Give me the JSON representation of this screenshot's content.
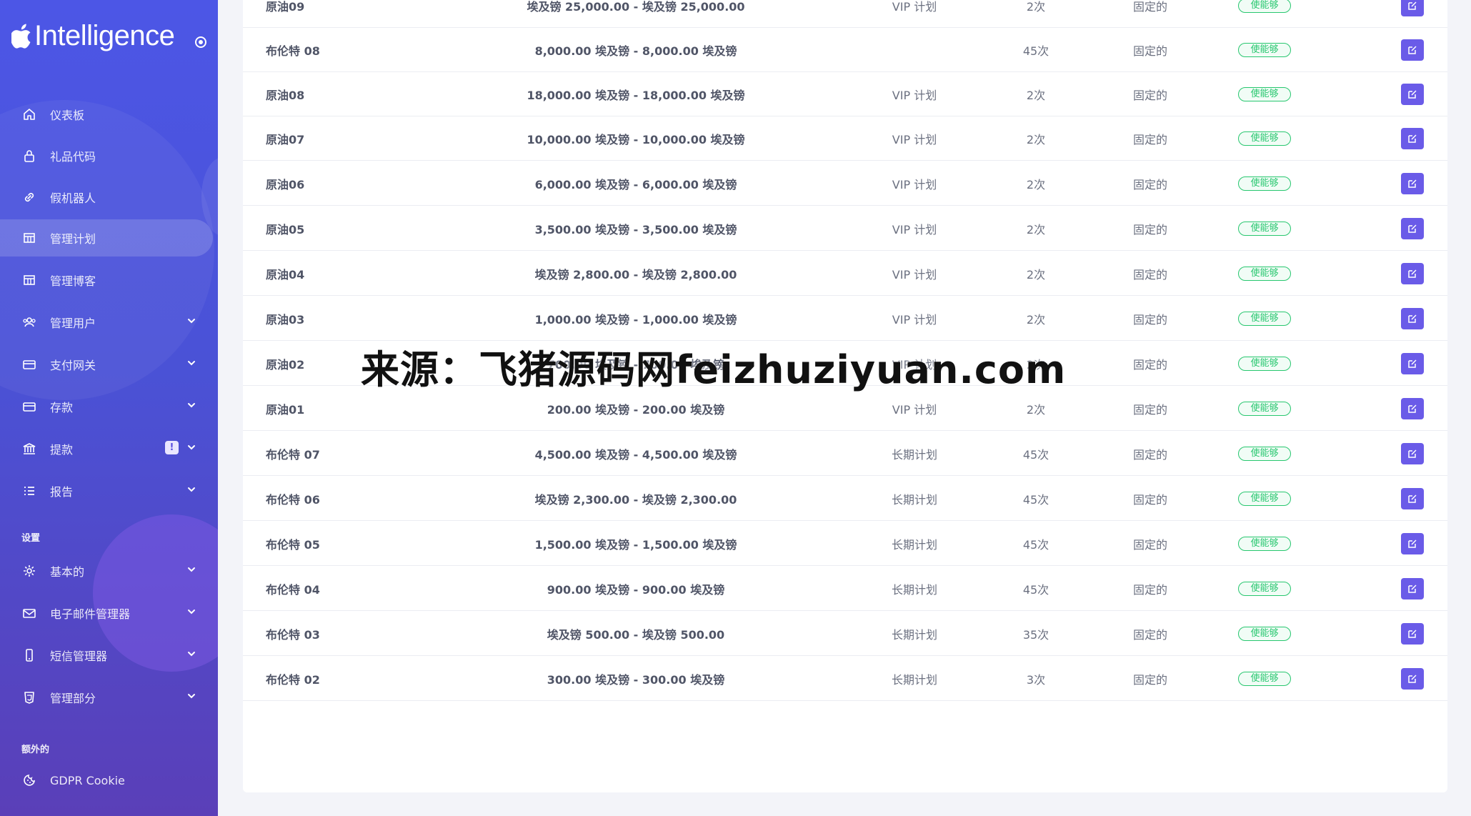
{
  "sidebar": {
    "brand": "Intelligence",
    "nav": [
      {
        "label": "仪表板",
        "icon": "home-icon"
      },
      {
        "label": "礼品代码",
        "icon": "lock-icon"
      },
      {
        "label": "假机器人",
        "icon": "link-icon"
      },
      {
        "label": "管理计划",
        "icon": "grid-icon",
        "active": true
      },
      {
        "label": "管理博客",
        "icon": "grid-icon"
      },
      {
        "label": "管理用户",
        "icon": "users-icon",
        "has_submenu": true
      },
      {
        "label": "支付网关",
        "icon": "card-icon",
        "has_submenu": true
      },
      {
        "label": "存款",
        "icon": "card-icon",
        "has_submenu": true
      },
      {
        "label": "提款",
        "icon": "bank-icon",
        "has_submenu": true,
        "badge": "!"
      },
      {
        "label": "报告",
        "icon": "list-icon",
        "has_submenu": true
      }
    ],
    "settings_section": "设置",
    "settings": [
      {
        "label": "基本的",
        "icon": "gear-icon"
      },
      {
        "label": "电子邮件管理器",
        "icon": "mail-icon"
      },
      {
        "label": "短信管理器",
        "icon": "phone-icon"
      },
      {
        "label": "管理部分",
        "icon": "html-icon"
      }
    ],
    "extra_section": "额外的",
    "extra": [
      {
        "label": "GDPR Cookie",
        "icon": "cookie-icon"
      }
    ]
  },
  "table": {
    "rows": [
      {
        "name": "原油09",
        "range": "埃及镑 25,000.00 - 埃及镑 25,000.00",
        "plan": "VIP 计划",
        "times": "2次",
        "type": "固定的",
        "status": "使能够"
      },
      {
        "name": "布伦特 08",
        "range": "8,000.00 埃及镑 - 8,000.00 埃及镑",
        "plan": "",
        "times": "45次",
        "type": "固定的",
        "status": "使能够"
      },
      {
        "name": "原油08",
        "range": "18,000.00 埃及镑 - 18,000.00 埃及镑",
        "plan": "VIP 计划",
        "times": "2次",
        "type": "固定的",
        "status": "使能够"
      },
      {
        "name": "原油07",
        "range": "10,000.00 埃及镑 - 10,000.00 埃及镑",
        "plan": "VIP 计划",
        "times": "2次",
        "type": "固定的",
        "status": "使能够"
      },
      {
        "name": "原油06",
        "range": "6,000.00 埃及镑 - 6,000.00 埃及镑",
        "plan": "VIP 计划",
        "times": "2次",
        "type": "固定的",
        "status": "使能够"
      },
      {
        "name": "原油05",
        "range": "3,500.00 埃及镑 - 3,500.00 埃及镑",
        "plan": "VIP 计划",
        "times": "2次",
        "type": "固定的",
        "status": "使能够"
      },
      {
        "name": "原油04",
        "range": "埃及镑 2,800.00 - 埃及镑 2,800.00",
        "plan": "VIP 计划",
        "times": "2次",
        "type": "固定的",
        "status": "使能够"
      },
      {
        "name": "原油03",
        "range": "1,000.00 埃及镑 - 1,000.00 埃及镑",
        "plan": "VIP 计划",
        "times": "2次",
        "type": "固定的",
        "status": "使能够"
      },
      {
        "name": "原油02",
        "range": "700.00 埃及镑 - 700.00 埃及镑",
        "plan": "VIP 计划",
        "times": "2次",
        "type": "固定的",
        "status": "使能够"
      },
      {
        "name": "原油01",
        "range": "200.00 埃及镑 - 200.00 埃及镑",
        "plan": "VIP 计划",
        "times": "2次",
        "type": "固定的",
        "status": "使能够"
      },
      {
        "name": "布伦特 07",
        "range": "4,500.00 埃及镑 - 4,500.00 埃及镑",
        "plan": "长期计划",
        "times": "45次",
        "type": "固定的",
        "status": "使能够"
      },
      {
        "name": "布伦特 06",
        "range": "埃及镑 2,300.00 - 埃及镑 2,300.00",
        "plan": "长期计划",
        "times": "45次",
        "type": "固定的",
        "status": "使能够"
      },
      {
        "name": "布伦特 05",
        "range": "1,500.00 埃及镑 - 1,500.00 埃及镑",
        "plan": "长期计划",
        "times": "45次",
        "type": "固定的",
        "status": "使能够"
      },
      {
        "name": "布伦特 04",
        "range": "900.00 埃及镑 - 900.00 埃及镑",
        "plan": "长期计划",
        "times": "45次",
        "type": "固定的",
        "status": "使能够"
      },
      {
        "name": "布伦特 03",
        "range": "埃及镑 500.00 - 埃及镑 500.00",
        "plan": "长期计划",
        "times": "35次",
        "type": "固定的",
        "status": "使能够"
      },
      {
        "name": "布伦特 02",
        "range": "300.00 埃及镑 - 300.00 埃及镑",
        "plan": "长期计划",
        "times": "3次",
        "type": "固定的",
        "status": "使能够"
      }
    ]
  },
  "watermark": "来源：飞猪源码网feizhuziyuan.com",
  "colors": {
    "sidebar_top": "#4c56e6",
    "sidebar_bottom": "#5a3fb8",
    "status_green": "#28c76f",
    "edit_purple": "#6a5be8"
  }
}
